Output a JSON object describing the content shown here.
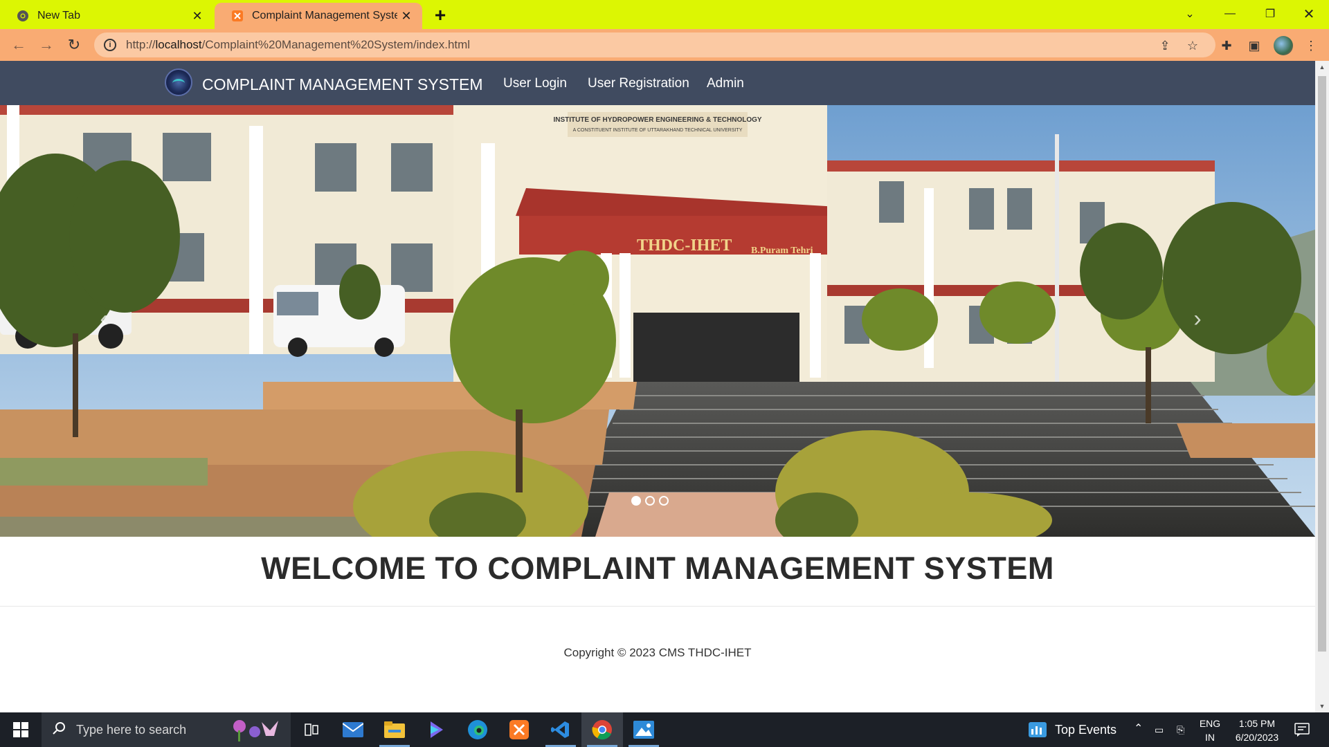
{
  "browser": {
    "tabs": [
      {
        "title": "New Tab",
        "active": false
      },
      {
        "title": "Complaint Management System",
        "active": true
      }
    ],
    "url_prefix": "http://",
    "url_host": "localhost",
    "url_path": "/Complaint%20Management%20System/index.html"
  },
  "site": {
    "brand": "COMPLAINT MANAGEMENT SYSTEM",
    "nav": {
      "user_login": "User Login",
      "user_registration": "User Registration",
      "admin": "Admin"
    },
    "carousel": {
      "prev_icon": "‹",
      "next_icon": "›",
      "building_sign": "THDC-IHET",
      "building_sign_sub": "B.Puram Tehri",
      "building_top_text": "INSTITUTE OF HYDROPOWER ENGINEERING & TECHNOLOGY",
      "building_top_sub": "A CONSTITUENT INSTITUTE OF UTTARAKHAND TECHNICAL UNIVERSITY",
      "slides": 3,
      "active_slide": 1
    },
    "welcome": "WELCOME TO COMPLAINT MANAGEMENT SYSTEM",
    "footer": "Copyright © 2023 CMS THDC-IHET"
  },
  "taskbar": {
    "search_placeholder": "Type here to search",
    "weather": "Top Events",
    "lang_1": "ENG",
    "lang_2": "IN",
    "time": "1:05 PM",
    "date": "6/20/2023"
  },
  "colors": {
    "tabbar": "#dcf603",
    "active_tab": "#f9ab73",
    "navbar": "#404b60",
    "taskbar": "#1c2027"
  }
}
